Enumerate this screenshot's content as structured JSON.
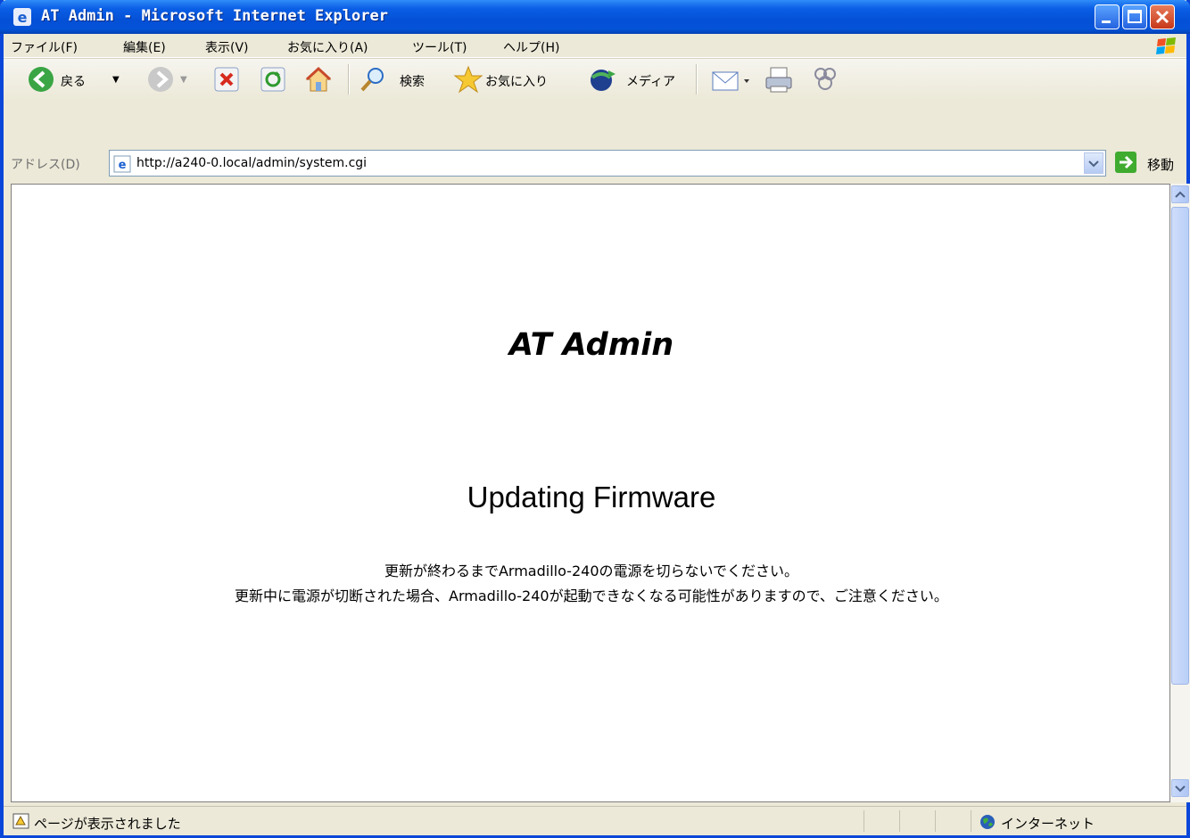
{
  "window": {
    "title": "AT Admin - Microsoft Internet Explorer"
  },
  "menu": {
    "items": [
      "ファイル(F)",
      "編集(E)",
      "表示(V)",
      "お気に入り(A)",
      "ツール(T)",
      "ヘルプ(H)"
    ]
  },
  "toolbar": {
    "back_label": "戻る",
    "search_label": "検索",
    "favorites_label": "お気に入り",
    "media_label": "メディア"
  },
  "address": {
    "label": "アドレス(D)",
    "url": "http://a240-0.local/admin/system.cgi",
    "go_label": "移動"
  },
  "page": {
    "brand": "AT Admin",
    "heading": "Updating Firmware",
    "message_line1": "更新が終わるまでArmadillo-240の電源を切らないでください。",
    "message_line2": "更新中に電源が切断された場合、Armadillo-240が起動できなくなる可能性がありますので、ご注意ください。"
  },
  "status": {
    "text": "ページが表示されました",
    "zone": "インターネット"
  }
}
